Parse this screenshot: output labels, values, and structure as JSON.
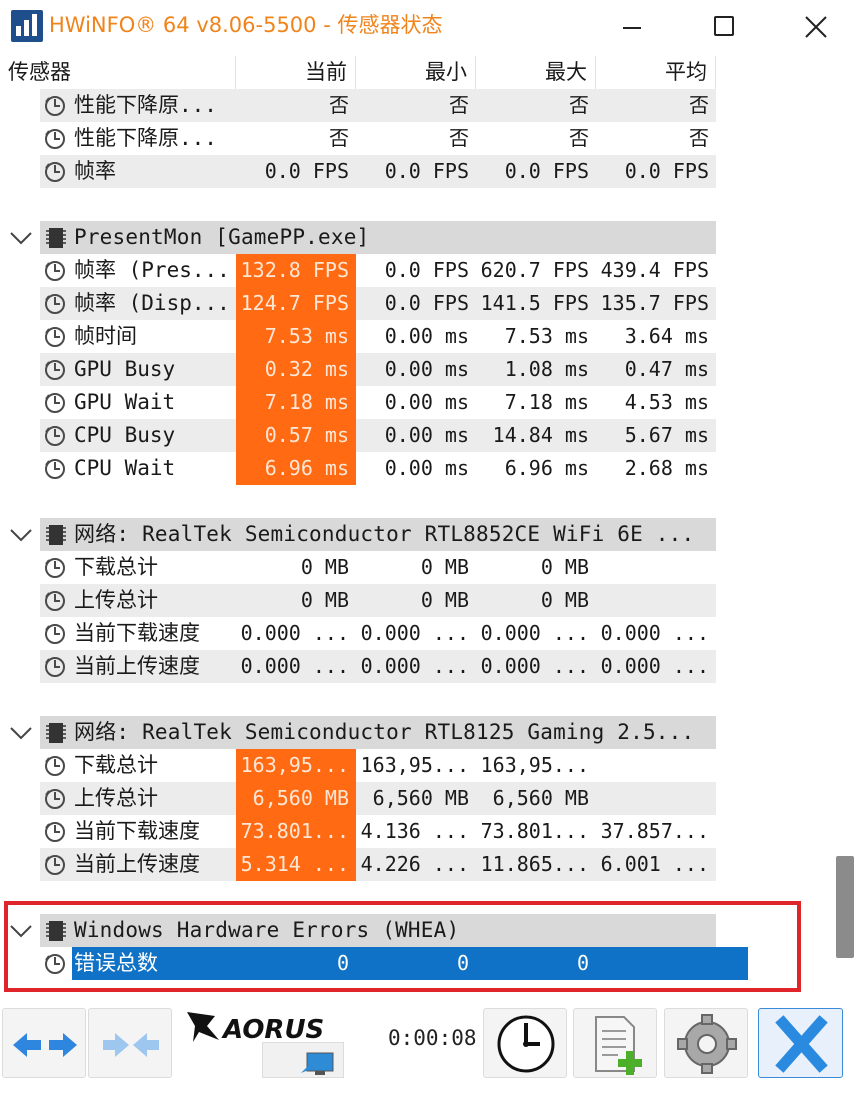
{
  "window": {
    "title": "HWiNFO® 64 v8.06-5500 - 传感器状态"
  },
  "header": {
    "sensor": "传感器",
    "current": "当前",
    "min": "最小",
    "max": "最大",
    "avg": "平均"
  },
  "rows": [
    {
      "type": "sensor",
      "alt": true,
      "name": "性能下降原...",
      "v": [
        "否",
        "否",
        "否",
        "否"
      ]
    },
    {
      "type": "sensor",
      "alt": false,
      "name": "性能下降原...",
      "v": [
        "否",
        "否",
        "否",
        "否"
      ]
    },
    {
      "type": "sensor",
      "alt": true,
      "name": "帧率",
      "v": [
        "0.0 FPS",
        "0.0 FPS",
        "0.0 FPS",
        "0.0 FPS"
      ]
    },
    {
      "type": "blank"
    },
    {
      "type": "group",
      "name": "PresentMon [GamePP.exe]"
    },
    {
      "type": "sensor",
      "alt": false,
      "name": "帧率 (Pres...",
      "v": [
        "132.8 FPS",
        "0.0 FPS",
        "620.7 FPS",
        "439.4 FPS"
      ],
      "hot": true
    },
    {
      "type": "sensor",
      "alt": true,
      "name": "帧率 (Disp...",
      "v": [
        "124.7 FPS",
        "0.0 FPS",
        "141.5 FPS",
        "135.7 FPS"
      ],
      "hot": true
    },
    {
      "type": "sensor",
      "alt": false,
      "name": "帧时间",
      "v": [
        "7.53 ms",
        "0.00 ms",
        "7.53 ms",
        "3.64 ms"
      ],
      "hot": true
    },
    {
      "type": "sensor",
      "alt": true,
      "name": "GPU Busy",
      "v": [
        "0.32 ms",
        "0.00 ms",
        "1.08 ms",
        "0.47 ms"
      ],
      "hot": true
    },
    {
      "type": "sensor",
      "alt": false,
      "name": "GPU Wait",
      "v": [
        "7.18 ms",
        "0.00 ms",
        "7.18 ms",
        "4.53 ms"
      ],
      "hot": true
    },
    {
      "type": "sensor",
      "alt": true,
      "name": "CPU Busy",
      "v": [
        "0.57 ms",
        "0.00 ms",
        "14.84 ms",
        "5.67 ms"
      ],
      "hot": true
    },
    {
      "type": "sensor",
      "alt": false,
      "name": "CPU Wait",
      "v": [
        "6.96 ms",
        "0.00 ms",
        "6.96 ms",
        "2.68 ms"
      ],
      "hot": true
    },
    {
      "type": "blank"
    },
    {
      "type": "group",
      "name": "网络: RealTek Semiconductor RTL8852CE WiFi 6E ..."
    },
    {
      "type": "sensor",
      "alt": false,
      "name": "下载总计",
      "v": [
        "0 MB",
        "0 MB",
        "0 MB",
        ""
      ]
    },
    {
      "type": "sensor",
      "alt": true,
      "name": "上传总计",
      "v": [
        "0 MB",
        "0 MB",
        "0 MB",
        ""
      ]
    },
    {
      "type": "sensor",
      "alt": false,
      "name": "当前下载速度",
      "v": [
        "0.000 ...",
        "0.000 ...",
        "0.000 ...",
        "0.000 ..."
      ]
    },
    {
      "type": "sensor",
      "alt": true,
      "name": "当前上传速度",
      "v": [
        "0.000 ...",
        "0.000 ...",
        "0.000 ...",
        "0.000 ..."
      ]
    },
    {
      "type": "blank"
    },
    {
      "type": "group",
      "name": "网络: RealTek Semiconductor RTL8125 Gaming 2.5..."
    },
    {
      "type": "sensor",
      "alt": false,
      "name": "下载总计",
      "v": [
        "163,95...",
        "163,95...",
        "163,95...",
        ""
      ],
      "hot": true
    },
    {
      "type": "sensor",
      "alt": true,
      "name": "上传总计",
      "v": [
        "6,560 MB",
        "6,560 MB",
        "6,560 MB",
        ""
      ],
      "hot": true
    },
    {
      "type": "sensor",
      "alt": false,
      "name": "当前下载速度",
      "v": [
        "73.801...",
        "4.136 ...",
        "73.801...",
        "37.857..."
      ],
      "hot": true
    },
    {
      "type": "sensor",
      "alt": true,
      "name": "当前上传速度",
      "v": [
        "5.314 ...",
        "4.226 ...",
        "11.865...",
        "6.001 ..."
      ],
      "hot": true
    },
    {
      "type": "blank"
    },
    {
      "type": "group",
      "name": "Windows Hardware Errors (WHEA)"
    },
    {
      "type": "sensor",
      "alt": false,
      "selected": true,
      "name": "错误总数",
      "v": [
        "0",
        "0",
        "0",
        ""
      ]
    }
  ],
  "toolbar": {
    "logo_text": "AORUS",
    "timer": "0:00:08"
  },
  "colors": {
    "accent_title": "#f0841b",
    "hot_cell": "#ff6a13",
    "selection": "#0f72c7",
    "highlight_box": "#e0242b"
  }
}
